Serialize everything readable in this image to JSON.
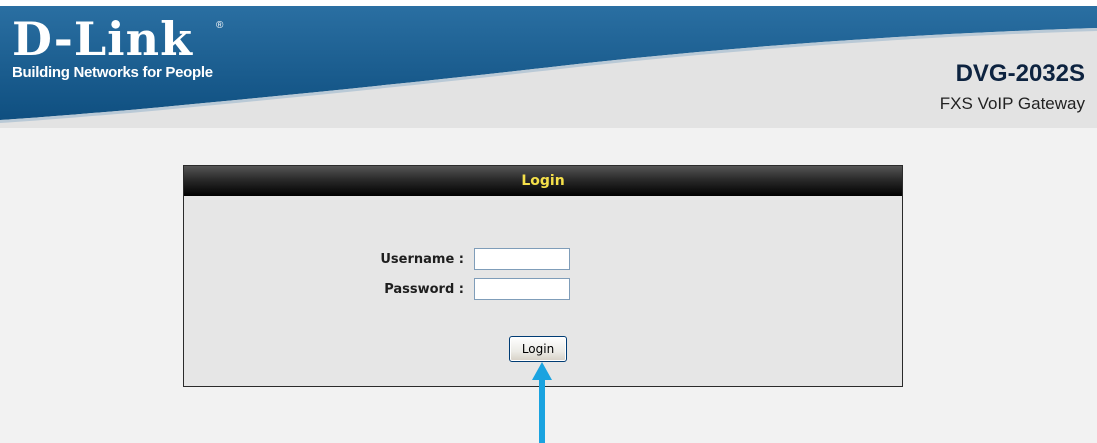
{
  "header": {
    "brand": "D-Link",
    "brand_registered": "®",
    "tagline": "Building Networks for People",
    "model_name": "DVG-2032S",
    "model_description": "FXS VoIP Gateway"
  },
  "login": {
    "title": "Login",
    "username_label": "Username :",
    "username_value": "",
    "password_label": "Password :",
    "password_value": "",
    "submit_label": "Login"
  },
  "colors": {
    "header_blue": "#1c5e8e",
    "title_text": "#f5e04a",
    "annotation_arrow": "#1aa3e0"
  },
  "icons": {
    "annotation": "up-arrow-icon"
  }
}
